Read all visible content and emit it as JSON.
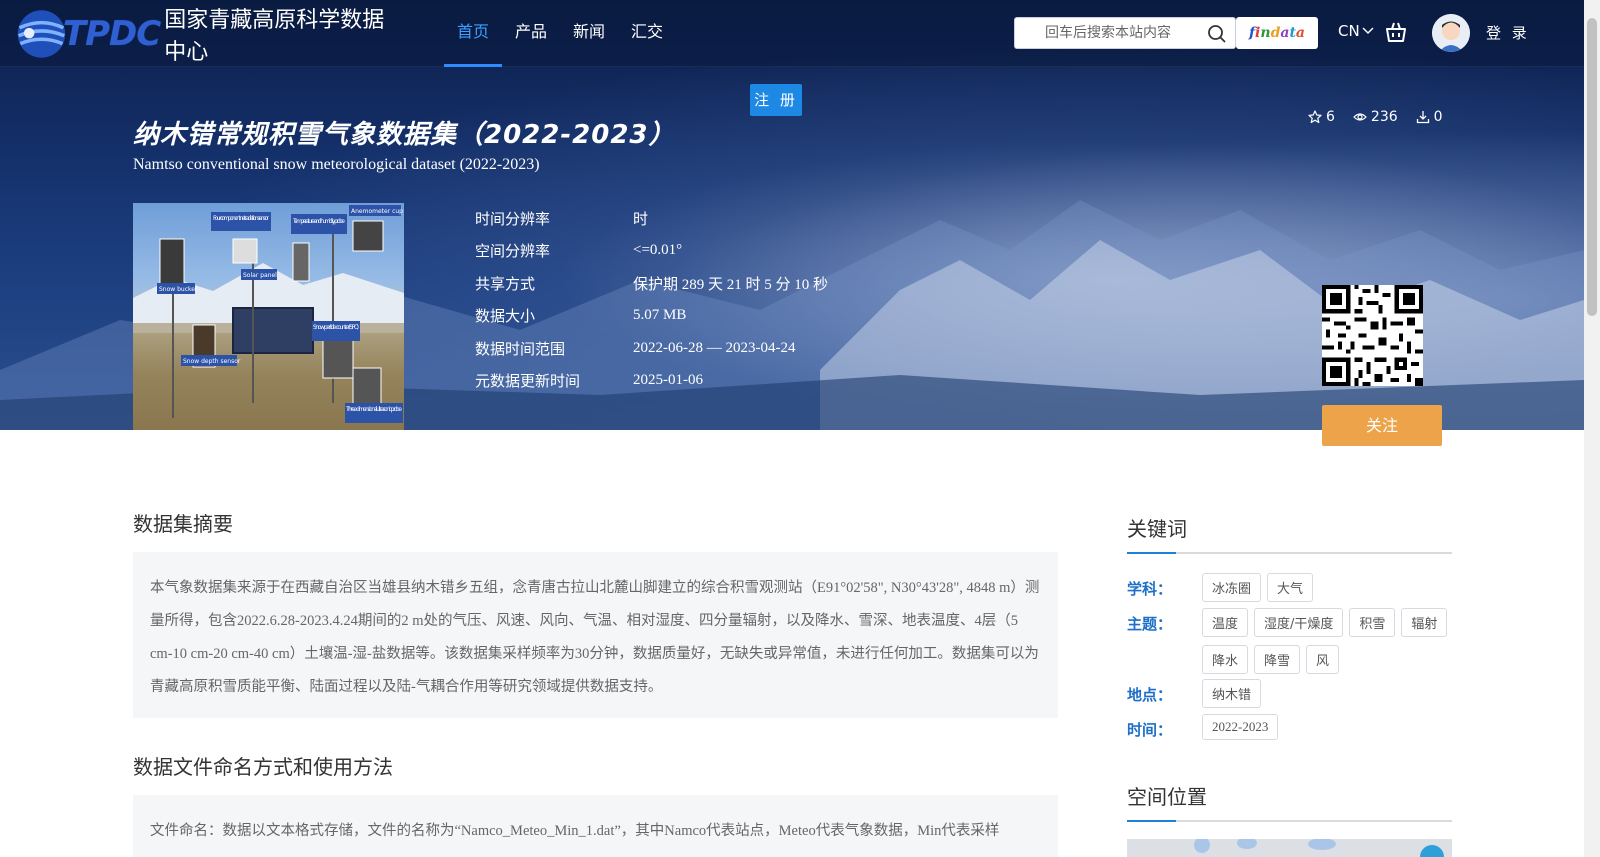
{
  "header": {
    "logo_text": "TPDC",
    "logo_cn": "国家青藏高原科学数据中心",
    "nav": [
      {
        "label": "首页",
        "active": true
      },
      {
        "label": "产品",
        "active": false
      },
      {
        "label": "新闻",
        "active": false
      },
      {
        "label": "汇交",
        "active": false
      }
    ],
    "search_placeholder": "回车后搜索本站内容",
    "findata_label": "findata",
    "lang_label": "CN",
    "login_label": "登 录"
  },
  "hero": {
    "register_label": "注 册",
    "title_cn": "纳木错常规积雪气象数据集（2022-2023）",
    "title_en": "Namtso conventional snow meteorological dataset (2022-2023)",
    "stats": {
      "stars": "6",
      "views": "236",
      "downloads": "0"
    },
    "image_labels": [
      "Four-component net radiation sensor",
      "Temperature and humidity probe",
      "Anemometer cup",
      "Solar panel",
      "Snow bucket",
      "Snow particle counter(SPC)",
      "Snow depth sensor",
      "Three-dimensional ultrasonic probe"
    ],
    "meta": [
      {
        "label": "时间分辨率",
        "value": "时"
      },
      {
        "label": "空间分辨率",
        "value": "<=0.01°"
      },
      {
        "label": "共享方式",
        "value": "保护期 289 天 21 时 5 分 10 秒"
      },
      {
        "label": "数据大小",
        "value": "5.07 MB"
      },
      {
        "label": "数据时间范围",
        "value": "2022-06-28 — 2023-04-24"
      },
      {
        "label": "元数据更新时间",
        "value": "2025-01-06"
      }
    ],
    "follow_label": "关注"
  },
  "main": {
    "abstract_title": "数据集摘要",
    "abstract_text": "本气象数据集来源于在西藏自治区当雄县纳木错乡五组，念青唐古拉山北麓山脚建立的综合积雪观测站（E91°02'58\", N30°43'28\", 4848 m）测量所得，包含2022.6.28-2023.4.24期间的2 m处的气压、风速、风向、气温、相对湿度、四分量辐射，以及降水、雪深、地表温度、4层（5 cm-10 cm-20 cm-40 cm）土壤温-湿-盐数据等。该数据集采样频率为30分钟，数据质量好，无缺失或异常值，未进行任何加工。数据集可以为青藏高原积雪质能平衡、陆面过程以及陆-气耦合作用等研究领域提供数据支持。",
    "naming_title": "数据文件命名方式和使用方法",
    "naming_text": "文件命名：数据以文本格式存储，文件的名称为“Namco_Meteo_Min_1.dat”，其中Namco代表站点，Meteo代表气象数据，Min代表采样"
  },
  "sidebar": {
    "keywords_title": "关键词",
    "groups": [
      {
        "label": "学科：",
        "tags": [
          "冰冻圈",
          "大气"
        ]
      },
      {
        "label": "主题：",
        "tags": [
          "温度",
          "湿度/干燥度",
          "积雪",
          "辐射",
          "降水",
          "降雪",
          "风"
        ]
      },
      {
        "label": "地点：",
        "tags": [
          "纳木错"
        ]
      },
      {
        "label": "时间：",
        "tags": [
          "2022-2023"
        ]
      }
    ],
    "location_title": "空间位置"
  },
  "colors": {
    "accent": "#1e88e5",
    "follow": "#eda349",
    "nav_active": "#3ea0ff",
    "keyword_label": "#1e6fc8"
  }
}
